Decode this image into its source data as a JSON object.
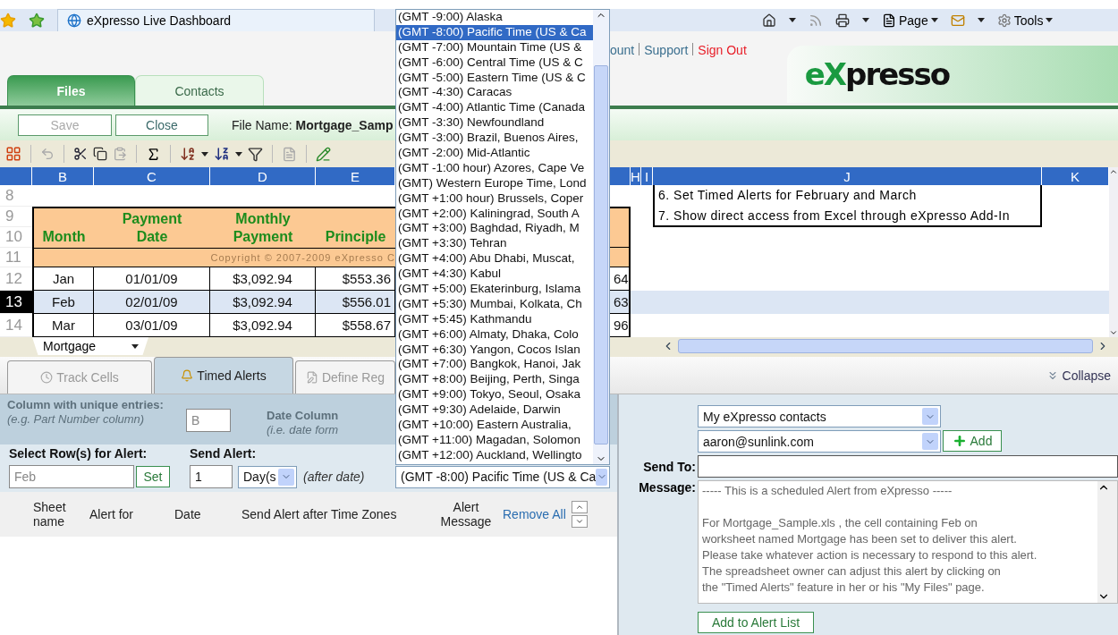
{
  "browser": {
    "tab_title": "eXpresso Live Dashboard",
    "menus": [
      "Page",
      "Tools"
    ]
  },
  "header": {
    "links": [
      {
        "label": "ount",
        "kind": "link"
      },
      {
        "label": "Support",
        "kind": "link"
      },
      {
        "label": "Sign Out",
        "kind": "signout"
      }
    ],
    "logo": {
      "accent": "eX",
      "rest": "presso"
    }
  },
  "main_tabs": [
    {
      "label": "Files",
      "selected": true
    },
    {
      "label": "Contacts",
      "selected": false
    }
  ],
  "file_bar": {
    "buttons": [
      {
        "label": "Save",
        "disabled": true
      },
      {
        "label": "Close",
        "disabled": false
      }
    ],
    "file_name_label": "File Name:",
    "file_name": "Mortgage_Samp"
  },
  "sheet": {
    "columns": [
      "B",
      "C",
      "D",
      "E"
    ],
    "right_columns": [
      "H",
      "I",
      "J",
      "K"
    ],
    "header_row_numbers": [
      "8",
      "9",
      "10",
      "11"
    ],
    "table_headers": [
      {
        "lines": [
          "Month"
        ]
      },
      {
        "lines": [
          "Payment",
          "Date"
        ]
      },
      {
        "lines": [
          "Monthly",
          "Payment"
        ]
      },
      {
        "lines": [
          "Principle"
        ]
      }
    ],
    "copyright": "Copyright © 2007-2009 eXpresso C",
    "rows": [
      {
        "number": "12",
        "cells": [
          "Jan",
          "01/01/09",
          "$3,092.94",
          "$553.36"
        ],
        "tail": "64",
        "selected": false
      },
      {
        "number": "13",
        "cells": [
          "Feb",
          "02/01/09",
          "$3,092.94",
          "$556.01"
        ],
        "tail": "63",
        "selected": true
      },
      {
        "number": "14",
        "cells": [
          "Mar",
          "03/01/09",
          "$3,092.94",
          "$558.67"
        ],
        "tail": "96",
        "selected": false
      }
    ],
    "notes": [
      "6. Set Timed Alerts for February and March",
      "7. Show direct access from Excel through eXpresso Add-In"
    ],
    "sheet_tab": "Mortgage"
  },
  "panel_tabs": [
    {
      "label": "Track Cells",
      "selected": false
    },
    {
      "label": "Timed Alerts",
      "selected": true
    },
    {
      "label": "Define Reg",
      "selected": false
    }
  ],
  "collapse": "Collapse",
  "alert_form": {
    "column_label": "Column with unique entries:",
    "column_hint": "(e.g. Part Number column)",
    "column_value": "B",
    "date_label": "Date Column",
    "date_hint": "(i.e. date form",
    "select_rows_label": "Select Row(s) for Alert:",
    "rows_value": "Feb",
    "set_button": "Set",
    "send_alert_label": "Send Alert:",
    "offset_value": "1",
    "unit_value": "Day(s",
    "after_label": "(after date)",
    "timezone_value": "(GMT -8:00) Pacific Time (US & Ca"
  },
  "timezone_list": [
    {
      "label": "(GMT -9:00) Alaska",
      "selected": false
    },
    {
      "label": "(GMT -8:00) Pacific Time (US & Ca",
      "selected": true
    },
    {
      "label": "(GMT -7:00) Mountain Time (US &",
      "selected": false
    },
    {
      "label": "(GMT -6:00) Central Time (US & C",
      "selected": false
    },
    {
      "label": "(GMT -5:00) Eastern Time (US & C",
      "selected": false
    },
    {
      "label": "(GMT -4:30) Caracas",
      "selected": false
    },
    {
      "label": "(GMT -4:00) Atlantic Time (Canada",
      "selected": false
    },
    {
      "label": "(GMT -3:30) Newfoundland",
      "selected": false
    },
    {
      "label": "(GMT -3:00) Brazil, Buenos Aires,",
      "selected": false
    },
    {
      "label": "(GMT -2:00) Mid-Atlantic",
      "selected": false
    },
    {
      "label": "(GMT -1:00 hour) Azores, Cape Ve",
      "selected": false
    },
    {
      "label": "(GMT) Western Europe Time, Lond",
      "selected": false
    },
    {
      "label": "(GMT +1:00 hour) Brussels, Coper",
      "selected": false
    },
    {
      "label": "(GMT +2:00) Kaliningrad, South A",
      "selected": false
    },
    {
      "label": "(GMT +3:00) Baghdad, Riyadh, M",
      "selected": false
    },
    {
      "label": "(GMT +3:30) Tehran",
      "selected": false
    },
    {
      "label": "(GMT +4:00) Abu Dhabi, Muscat,",
      "selected": false
    },
    {
      "label": "(GMT +4:30) Kabul",
      "selected": false
    },
    {
      "label": "(GMT +5:00) Ekaterinburg, Islama",
      "selected": false
    },
    {
      "label": "(GMT +5:30) Mumbai, Kolkata, Ch",
      "selected": false
    },
    {
      "label": "(GMT +5:45) Kathmandu",
      "selected": false
    },
    {
      "label": "(GMT +6:00) Almaty, Dhaka, Colo",
      "selected": false
    },
    {
      "label": "(GMT +6:30) Yangon, Cocos Islan",
      "selected": false
    },
    {
      "label": "(GMT +7:00) Bangkok, Hanoi, Jak",
      "selected": false
    },
    {
      "label": "(GMT +8:00) Beijing, Perth, Singa",
      "selected": false
    },
    {
      "label": "(GMT +9:00) Tokyo, Seoul, Osaka",
      "selected": false
    },
    {
      "label": "(GMT +9:30) Adelaide, Darwin",
      "selected": false
    },
    {
      "label": "(GMT +10:00) Eastern Australia,",
      "selected": false
    },
    {
      "label": "(GMT +11:00) Magadan, Solomon",
      "selected": false
    },
    {
      "label": "(GMT +12:00) Auckland, Wellingto",
      "selected": false
    }
  ],
  "alert_table": {
    "columns": [
      "Sheet name",
      "Alert for",
      "Date",
      "Send Alert after",
      "Time Zones",
      "Alert Message"
    ],
    "remove_all": "Remove All"
  },
  "recipient": {
    "contacts_value": "My eXpresso contacts",
    "email_value": "aaron@sunlink.com",
    "add_button": "Add",
    "send_to_label": "Send To:",
    "message_label": "Message:",
    "message": "----- This is a scheduled Alert from eXpresso -----\n\nFor Mortgage_Sample.xls , the cell containing Feb on\nworksheet named Mortgage has been set to deliver this alert.\nPlease take whatever action is necessary to respond to this alert.\nThe spreadsheet owner can adjust this alert by clicking on\nthe \"Timed Alerts\" feature in her or his \"My Files\" page.",
    "add_to_list_button": "Add to Alert List"
  }
}
